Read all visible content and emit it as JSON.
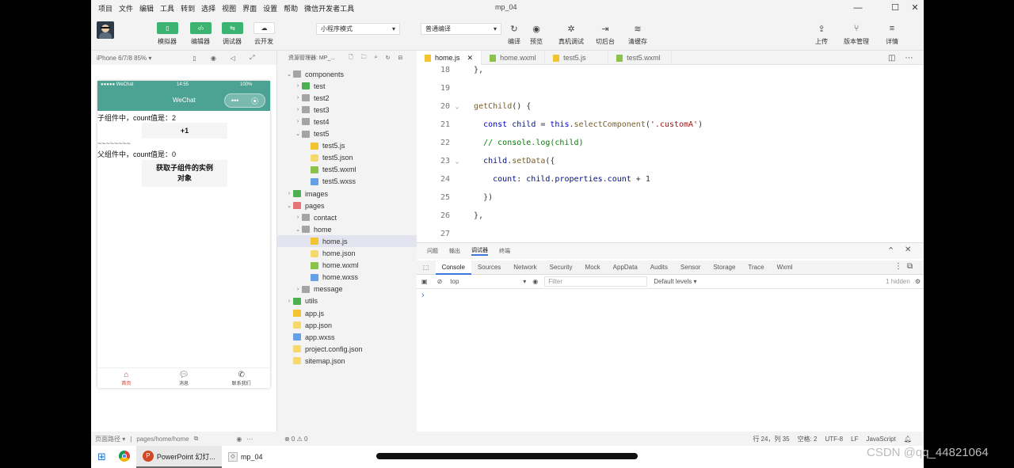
{
  "menubar": [
    "项目",
    "文件",
    "编辑",
    "工具",
    "转到",
    "选择",
    "视图",
    "界面",
    "设置",
    "帮助",
    "微信开发者工具"
  ],
  "window_title": "mp_04",
  "toolbar": {
    "simulator": "模拟器",
    "editor": "编辑器",
    "debugger": "调试器",
    "cloud": "云开发",
    "mode_select": "小程序模式",
    "compile_select": "普通编译",
    "compile": "编译",
    "preview": "预览",
    "real_debug": "真机调试",
    "background": "切后台",
    "clear_cache": "清缓存",
    "upload": "上传",
    "version": "版本管理",
    "details": "详情"
  },
  "simulator": {
    "device": "iPhone 6/7/8 85% ▾",
    "status_carrier": "●●●●● WeChat",
    "status_time": "14:55",
    "status_battery": "100%",
    "nav_title": "WeChat",
    "child_count_text": "子组件中，count值是：2",
    "plus_button": "+1",
    "divider": "~~~~~~~~",
    "parent_count_text": "父组件中，count值是：0",
    "get_instance_button": "获取子组件的实例对象",
    "tabs": [
      {
        "label": "首页",
        "icon": "home-icon"
      },
      {
        "label": "消息",
        "icon": "message-icon"
      },
      {
        "label": "联系我们",
        "icon": "contact-icon"
      }
    ],
    "footer_path_label": "页面路径 ▾",
    "footer_path": "pages/home/home"
  },
  "explorer": {
    "title": "资源管理器: MP_...",
    "tree": [
      {
        "label": "components",
        "type": "folder",
        "depth": 0,
        "open": true
      },
      {
        "label": "test",
        "type": "folder-green",
        "depth": 1,
        "open": false
      },
      {
        "label": "test2",
        "type": "folder",
        "depth": 1,
        "open": false
      },
      {
        "label": "test3",
        "type": "folder",
        "depth": 1,
        "open": false
      },
      {
        "label": "test4",
        "type": "folder",
        "depth": 1,
        "open": false
      },
      {
        "label": "test5",
        "type": "folder",
        "depth": 1,
        "open": true
      },
      {
        "label": "test5.js",
        "type": "js",
        "depth": 2
      },
      {
        "label": "test5.json",
        "type": "json",
        "depth": 2
      },
      {
        "label": "test5.wxml",
        "type": "wxml",
        "depth": 2
      },
      {
        "label": "test5.wxss",
        "type": "wxss",
        "depth": 2
      },
      {
        "label": "images",
        "type": "folder-green",
        "depth": 0,
        "open": false
      },
      {
        "label": "pages",
        "type": "folder-red",
        "depth": 0,
        "open": true
      },
      {
        "label": "contact",
        "type": "folder",
        "depth": 1,
        "open": false
      },
      {
        "label": "home",
        "type": "folder",
        "depth": 1,
        "open": true
      },
      {
        "label": "home.js",
        "type": "js",
        "depth": 2,
        "selected": true
      },
      {
        "label": "home.json",
        "type": "json",
        "depth": 2
      },
      {
        "label": "home.wxml",
        "type": "wxml",
        "depth": 2
      },
      {
        "label": "home.wxss",
        "type": "wxss",
        "depth": 2
      },
      {
        "label": "message",
        "type": "folder",
        "depth": 1,
        "open": false
      },
      {
        "label": "utils",
        "type": "folder-green",
        "depth": 0,
        "open": false
      },
      {
        "label": "app.js",
        "type": "js",
        "depth": 0
      },
      {
        "label": "app.json",
        "type": "json",
        "depth": 0
      },
      {
        "label": "app.wxss",
        "type": "wxss",
        "depth": 0
      },
      {
        "label": "project.config.json",
        "type": "json",
        "depth": 0
      },
      {
        "label": "sitemap.json",
        "type": "json",
        "depth": 0
      }
    ],
    "footer": "⊗ 0 ⚠ 0"
  },
  "editor": {
    "tabs": [
      {
        "label": "home.js",
        "icon": "js",
        "active": true
      },
      {
        "label": "home.wxml",
        "icon": "wxml",
        "active": false
      },
      {
        "label": "test5.js",
        "icon": "js",
        "active": false
      },
      {
        "label": "test5.wxml",
        "icon": "wxml",
        "active": false
      }
    ],
    "lines": [
      {
        "n": "18",
        "fold": "",
        "html": "  },"
      },
      {
        "n": "19",
        "fold": "",
        "html": ""
      },
      {
        "n": "20",
        "fold": "⌄",
        "html": "  <span class='fn'>getChild</span>() {"
      },
      {
        "n": "21",
        "fold": "",
        "html": "    <span class='kw'>const</span> <span class='prop'>child</span> = <span class='kw'>this</span>.<span class='fn'>selectComponent</span>(<span class='str'>'.customA'</span>)"
      },
      {
        "n": "22",
        "fold": "",
        "html": "    <span class='cmt'>// console.log(child)</span>"
      },
      {
        "n": "23",
        "fold": "⌄",
        "html": "    <span class='prop'>child</span>.<span class='fn'>setData</span>({"
      },
      {
        "n": "24",
        "fold": "",
        "html": "      <span class='prop'>count</span>: <span class='prop'>child</span>.<span class='prop'>properties</span>.<span class='prop'>count</span> + 1"
      },
      {
        "n": "25",
        "fold": "",
        "html": "    })"
      },
      {
        "n": "26",
        "fold": "",
        "html": "  },"
      },
      {
        "n": "27",
        "fold": "",
        "html": ""
      }
    ]
  },
  "console": {
    "top_tabs": [
      "问题",
      "输出",
      "调试器",
      "终端"
    ],
    "active_top": "调试器",
    "devtools_tabs": [
      "Console",
      "Sources",
      "Network",
      "Security",
      "Mock",
      "AppData",
      "Audits",
      "Sensor",
      "Storage",
      "Trace",
      "Wxml"
    ],
    "context": "top",
    "filter_placeholder": "Filter",
    "levels": "Default levels ▾",
    "hidden": "1 hidden",
    "prompt": "›"
  },
  "statusbar": [
    "行 24，列 35",
    "空格: 2",
    "UTF-8",
    "LF",
    "JavaScript"
  ],
  "taskbar": {
    "items": [
      {
        "label": "PowerPoint 幻灯...",
        "icon": "powerpoint-icon"
      },
      {
        "label": "mp_04",
        "icon": "wechat-devtools-icon"
      }
    ]
  },
  "watermark": "CSDN @qq_44821064"
}
